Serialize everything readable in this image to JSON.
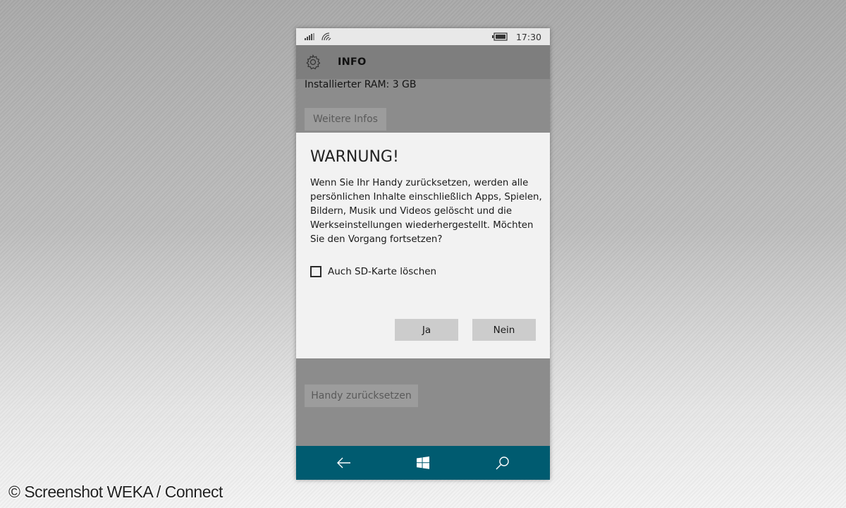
{
  "status_bar": {
    "time": "17:30",
    "icons": [
      "signal-icon",
      "wifi-icon",
      "battery-charging-icon"
    ]
  },
  "page": {
    "title": "INFO",
    "header_icon": "gear-icon",
    "ram_text": "Installierter RAM: 3 GB",
    "more_info_button": "Weitere Infos",
    "reset_button": "Handy zurücksetzen"
  },
  "dialog": {
    "title": "WARNUNG!",
    "body": "Wenn Sie Ihr Handy zurücksetzen, werden alle persönlichen Inhalte einschließlich Apps, Spielen, Bildern, Musik und Videos gelöscht und die Werkseinstellungen wiederhergestellt. Möchten Sie den Vorgang fortsetzen?",
    "checkbox_label": "Auch SD-Karte löschen",
    "checkbox_checked": false,
    "yes_button": "Ja",
    "no_button": "Nein"
  },
  "nav_bar": {
    "color": "#005b70",
    "icons": [
      "back-arrow-icon",
      "windows-start-icon",
      "search-icon"
    ]
  },
  "colors": {
    "dialog_bg": "#f2f2f2",
    "dialog_button": "#cccccc",
    "dimmed_page": "#8c8c8c"
  },
  "watermark": "© Screenshot WEKA / Connect"
}
